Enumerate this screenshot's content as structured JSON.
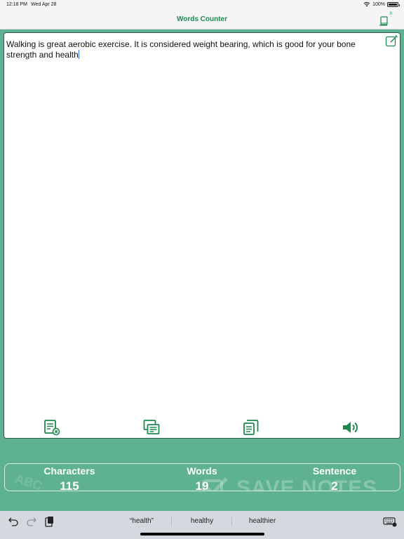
{
  "status_bar": {
    "time": "12:18 PM",
    "date": "Wed Apr 28",
    "battery": "100%",
    "battery_level": 1.0,
    "icons": [
      "wifi-icon",
      "battery-icon"
    ]
  },
  "nav": {
    "title": "Words Counter",
    "saved_notes_count": "0",
    "right_icon": "saved-notes-icon"
  },
  "editor": {
    "text": "Walking is great aerobic exercise. It is considered weight bearing, which is good for your bone strength and health",
    "edit_icon": "edit-note-icon"
  },
  "toolbar": {
    "icons": [
      "clear-text-icon",
      "paste-icon",
      "copy-icon",
      "speaker-icon"
    ]
  },
  "stats": {
    "characters_label": "Characters",
    "characters_value": "115",
    "words_label": "Words",
    "words_value": "19",
    "sentence_label": "Sentence",
    "sentence_value": "2"
  },
  "banner": {
    "left_text": "ABC",
    "save_notes_text": "SAVE NOTES"
  },
  "keyboard_bar": {
    "suggestions": [
      "“health”",
      "healthy",
      "healthier"
    ],
    "icons": [
      "undo-icon",
      "redo-icon",
      "paste-clipboard-icon",
      "keyboard-dismiss-icon"
    ]
  },
  "colors": {
    "accent": "#1d8a4e",
    "background": "#5fb291",
    "stats_text": "#ffffff"
  }
}
